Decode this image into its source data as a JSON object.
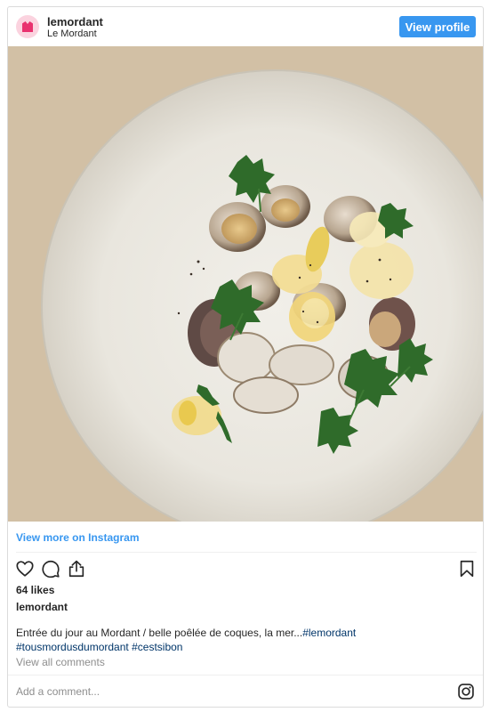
{
  "header": {
    "username": "lemordant",
    "full_name": "Le Mordant",
    "view_profile_label": "View profile"
  },
  "post": {
    "view_more_label": "View more on Instagram",
    "likes": "64 likes",
    "owner": "lemordant",
    "caption_text": "Entrée du jour au Mordant / belle poêlée de coques, la mer...",
    "caption_tag_1": "#lemordant",
    "caption_tag_2": "#tousmordusdumordant",
    "caption_tag_3": "#cestsibon",
    "view_comments_label": "View all comments"
  },
  "comment": {
    "placeholder": "Add a comment..."
  },
  "icons": {
    "like": "heart-icon",
    "comment": "comment-icon",
    "share": "share-icon",
    "save": "bookmark-icon",
    "instagram": "instagram-icon"
  },
  "colors": {
    "accent": "#3897f0",
    "hashtag": "#003569",
    "muted": "#8e8e8e"
  }
}
